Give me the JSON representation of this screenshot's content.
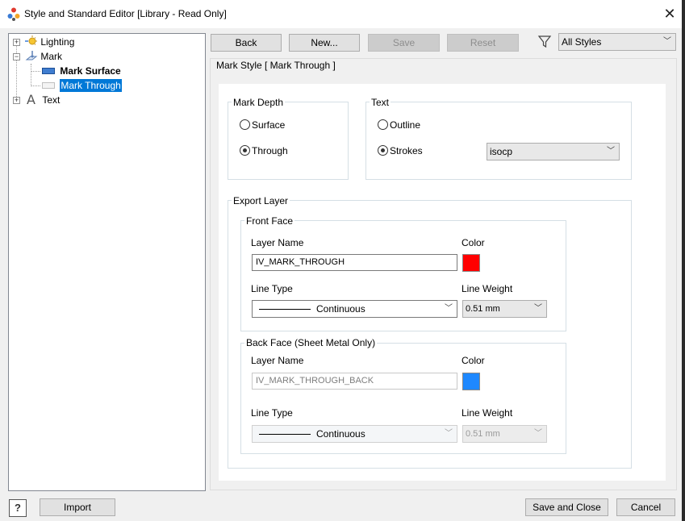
{
  "window": {
    "title": "Style and Standard Editor [Library - Read Only]",
    "close_glyph": "✕"
  },
  "tree": {
    "items": [
      {
        "label": "Lighting",
        "icon": "lighting-icon"
      },
      {
        "label": "Mark",
        "icon": "mark-icon"
      },
      {
        "label": "Mark Surface",
        "icon": "mark-surface-icon"
      },
      {
        "label": "Mark Through",
        "icon": "mark-through-icon"
      },
      {
        "label": "Text",
        "icon": "text-icon"
      }
    ]
  },
  "toolbar": {
    "back": "Back",
    "new": "New...",
    "save": "Save",
    "reset": "Reset",
    "filter_icon": "filter-icon",
    "filter_value": "All Styles"
  },
  "panel": {
    "title": "Mark Style [ Mark Through ]",
    "mark_depth": {
      "label": "Mark Depth",
      "surface": "Surface",
      "through": "Through",
      "selected": "Through"
    },
    "text": {
      "label": "Text",
      "outline": "Outline",
      "strokes": "Strokes",
      "selected": "Strokes",
      "font_value": "isocp"
    },
    "export_layer": {
      "label": "Export Layer",
      "front_face": {
        "label": "Front Face",
        "layer_name_label": "Layer Name",
        "layer_name_value": "IV_MARK_THROUGH",
        "color_label": "Color",
        "color": "#ff0000",
        "line_type_label": "Line Type",
        "line_type_value": "Continuous",
        "line_weight_label": "Line Weight",
        "line_weight_value": "0.51 mm"
      },
      "back_face": {
        "label": "Back Face (Sheet Metal Only)",
        "layer_name_label": "Layer Name",
        "layer_name_value": "IV_MARK_THROUGH_BACK",
        "color_label": "Color",
        "color": "#1e88ff",
        "line_type_label": "Line Type",
        "line_type_value": "Continuous",
        "line_weight_label": "Line Weight",
        "line_weight_value": "0.51 mm"
      }
    }
  },
  "footer": {
    "help": "?",
    "import": "Import",
    "save_close": "Save and Close",
    "cancel": "Cancel"
  },
  "colors": {
    "selection": "#0078d7",
    "accent": "#1e88ff"
  }
}
